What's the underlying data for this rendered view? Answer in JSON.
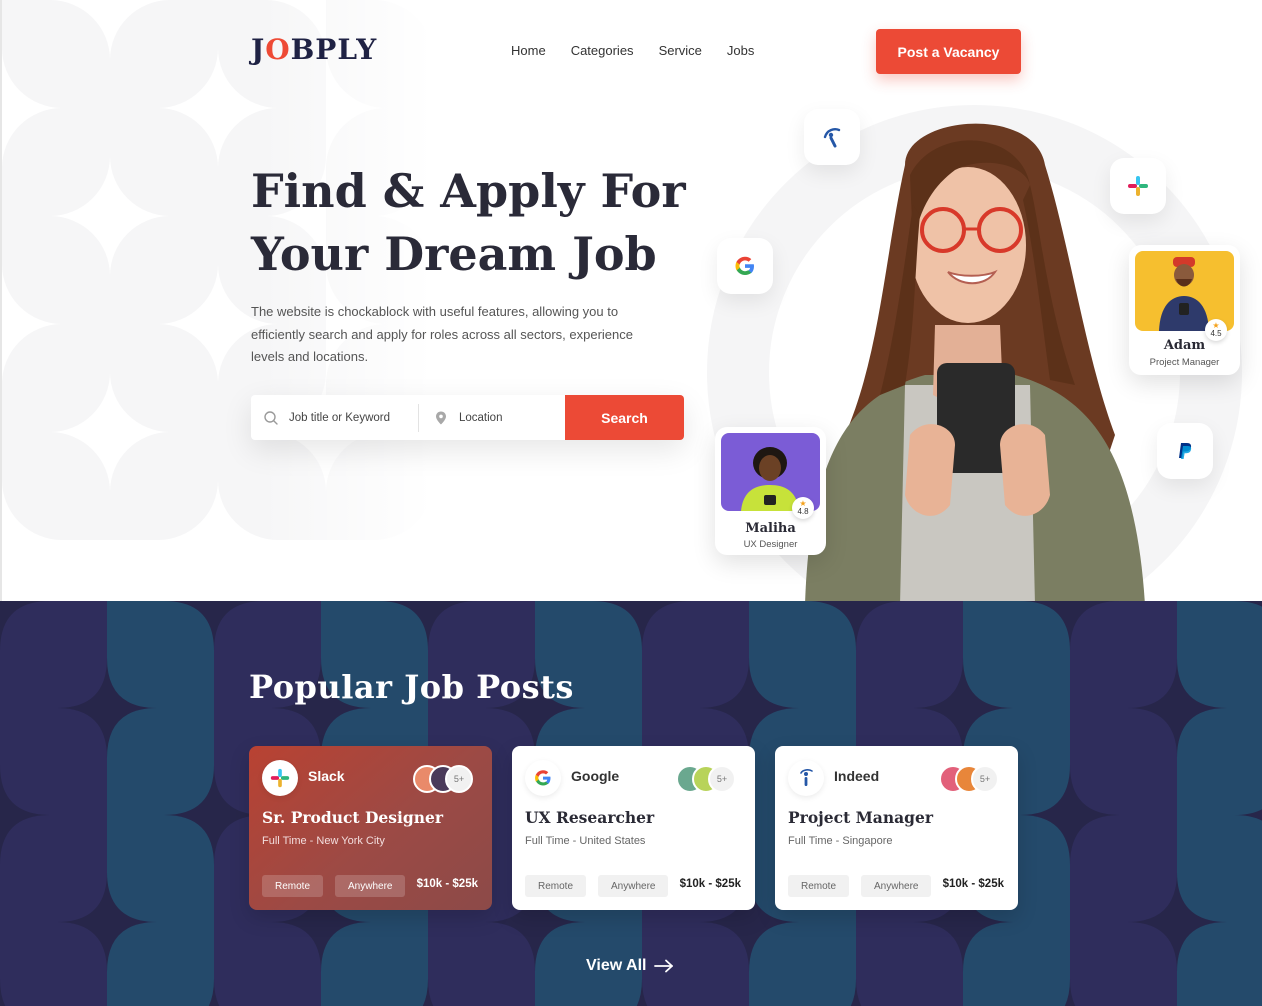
{
  "brand": {
    "logo_prefix": "J",
    "logo_o": "O",
    "logo_suffix": "BPLY",
    "accent": "#ec4a36",
    "dark": "#27264a"
  },
  "nav": {
    "items": [
      "Home",
      "Categories",
      "Service",
      "Jobs"
    ],
    "cta": "Post a Vacancy"
  },
  "hero": {
    "title_line1": "Find & Apply For",
    "title_line2": "Your Dream Job",
    "description": "The website is chockablock with useful features, allowing you to efficiently search and apply for roles across all sectors, experience levels and locations."
  },
  "search": {
    "keyword_placeholder": "Job title or Keyword",
    "location_placeholder": "Location",
    "button": "Search"
  },
  "profiles": [
    {
      "name": "Maliha",
      "role": "UX Designer",
      "rating": "4.8"
    },
    {
      "name": "Adam",
      "role": "Project Manager",
      "rating": "4.5"
    }
  ],
  "floating_icons": [
    "indeed-icon",
    "google-icon",
    "slack-icon",
    "paypal-icon"
  ],
  "jobs": {
    "title": "Popular Job Posts",
    "view_all": "View All",
    "cards": [
      {
        "company": "Slack",
        "title": "Sr. Product Designer",
        "meta": "Full Time - New York City",
        "tags": [
          "Remote",
          "Anywhere"
        ],
        "salary": "$10k - $25k",
        "applicants": "5+"
      },
      {
        "company": "Google",
        "title": "UX Researcher",
        "meta": "Full Time - United States",
        "tags": [
          "Remote",
          "Anywhere"
        ],
        "salary": "$10k - $25k",
        "applicants": "5+"
      },
      {
        "company": "Indeed",
        "title": "Project Manager",
        "meta": "Full Time - Singapore",
        "tags": [
          "Remote",
          "Anywhere"
        ],
        "salary": "$10k - $25k",
        "applicants": "5+"
      }
    ]
  }
}
